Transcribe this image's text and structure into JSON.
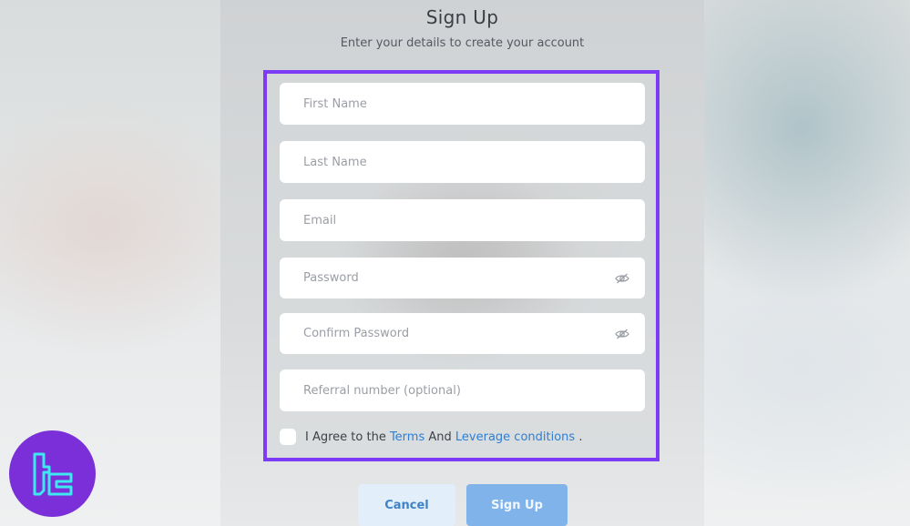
{
  "header": {
    "title": "Sign Up",
    "subtitle": "Enter your details to create your account"
  },
  "form": {
    "first_name": {
      "placeholder": "First Name",
      "value": ""
    },
    "last_name": {
      "placeholder": "Last Name",
      "value": ""
    },
    "email": {
      "placeholder": "Email",
      "value": ""
    },
    "password": {
      "placeholder": "Password",
      "value": "",
      "icon": "eye-slash-icon"
    },
    "confirm_password": {
      "placeholder": "Confirm Password",
      "value": "",
      "icon": "eye-slash-icon"
    },
    "referral": {
      "placeholder": "Referral number (optional)",
      "value": ""
    },
    "agree": {
      "checked": false,
      "prefix": "I Agree to the ",
      "terms_link": "Terms",
      "middle": " And ",
      "leverage_link": "Leverage conditions",
      "suffix": " ."
    }
  },
  "actions": {
    "cancel_label": "Cancel",
    "signup_label": "Sign Up"
  },
  "colors": {
    "highlight_border": "#7d3bf5",
    "link": "#2d7ed6",
    "signup_button": "#7fb3ea",
    "cancel_button": "#e2effa",
    "logo_bg": "#7a2fd8",
    "logo_mark": "#3ee8f0"
  },
  "logo": {
    "icon": "tc-logo-icon"
  }
}
